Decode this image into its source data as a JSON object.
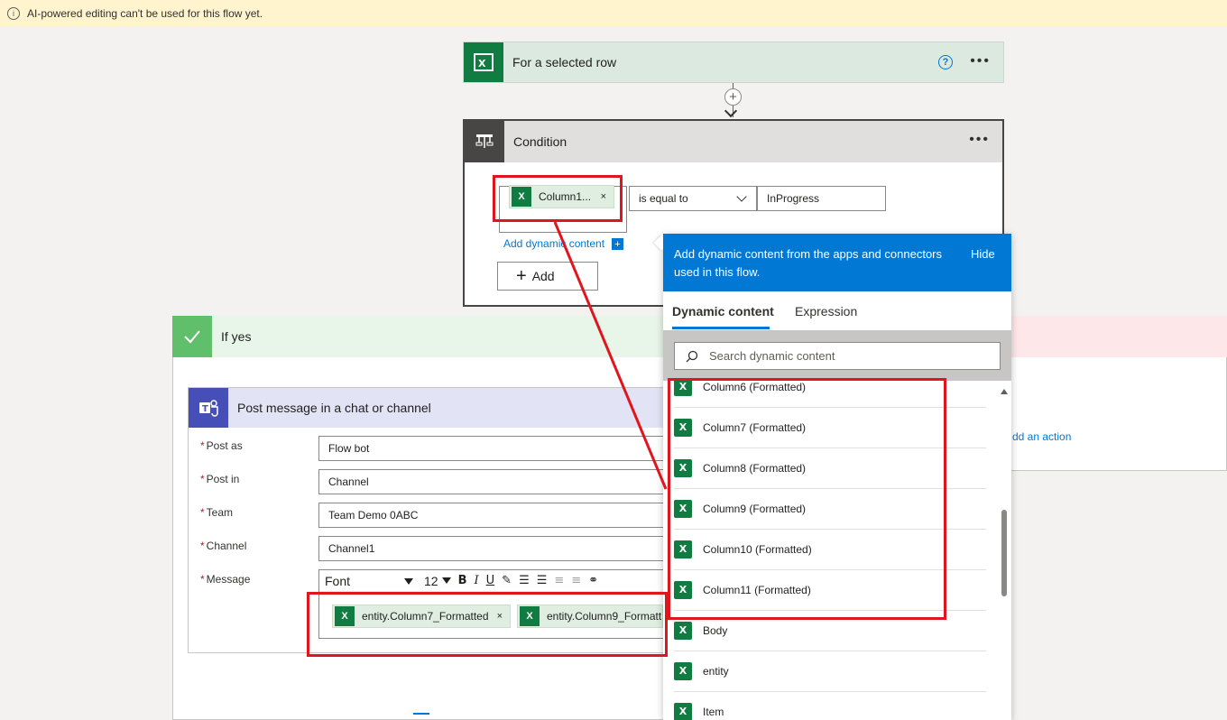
{
  "banner": {
    "text": "AI-powered editing can't be used for this flow yet."
  },
  "trigger": {
    "title": "For a selected row"
  },
  "condition": {
    "title": "Condition",
    "token": "Column1...",
    "operator": "is equal to",
    "value": "InProgress",
    "add_dynamic_link": "Add dynamic content",
    "add_button": "Add"
  },
  "if_yes": {
    "title": "If yes"
  },
  "if_no": {
    "add_action": "dd an action"
  },
  "teams_action": {
    "title": "Post message in a chat or channel",
    "fields": [
      {
        "label": "Post as",
        "value": "Flow bot"
      },
      {
        "label": "Post in",
        "value": "Channel"
      },
      {
        "label": "Team",
        "value": "Team Demo 0ABC"
      },
      {
        "label": "Channel",
        "value": "Channel1"
      }
    ],
    "message_label": "Message",
    "toolbar": {
      "font": "Font",
      "size": "12"
    },
    "message_tokens": [
      "entity.Column7_Formatted",
      "entity.Column9_Formatt"
    ]
  },
  "dynamic_panel": {
    "header_text": "Add dynamic content from the apps and connectors used in this flow.",
    "hide": "Hide",
    "tabs": [
      "Dynamic content",
      "Expression"
    ],
    "search_placeholder": "Search dynamic content",
    "items": [
      "Column6 (Formatted)",
      "Column7 (Formatted)",
      "Column8 (Formatted)",
      "Column9 (Formatted)",
      "Column10 (Formatted)",
      "Column11 (Formatted)",
      "Body",
      "entity",
      "Item"
    ]
  },
  "colors": {
    "accent": "#0078d4",
    "excel": "#107c41",
    "annotation": "#e0161f",
    "teams": "#464eb8"
  }
}
